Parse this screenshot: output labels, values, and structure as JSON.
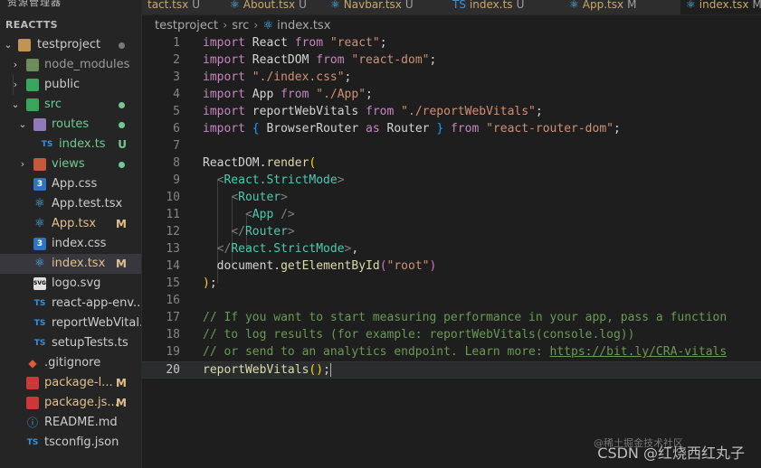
{
  "sidebar": {
    "header_partial": "资源管理器",
    "title": "REACTTS",
    "items": [
      {
        "label": "testproject",
        "status": "dot"
      },
      {
        "label": "node_modules",
        "status": ""
      },
      {
        "label": "public",
        "status": ""
      },
      {
        "label": "src",
        "status": "dot"
      },
      {
        "label": "routes",
        "status": "dot"
      },
      {
        "label": "index.ts",
        "status": "U"
      },
      {
        "label": "views",
        "status": "dot"
      },
      {
        "label": "App.css",
        "status": ""
      },
      {
        "label": "App.test.tsx",
        "status": ""
      },
      {
        "label": "App.tsx",
        "status": "M"
      },
      {
        "label": "index.css",
        "status": ""
      },
      {
        "label": "index.tsx",
        "status": "M"
      },
      {
        "label": "logo.svg",
        "status": ""
      },
      {
        "label": "react-app-env....",
        "status": ""
      },
      {
        "label": "reportWebVital...",
        "status": ""
      },
      {
        "label": "setupTests.ts",
        "status": ""
      },
      {
        "label": ".gitignore",
        "status": ""
      },
      {
        "label": "package-l...",
        "status": "M"
      },
      {
        "label": "package.js...",
        "status": "M"
      },
      {
        "label": "README.md",
        "status": ""
      },
      {
        "label": "tsconfig.json",
        "status": ""
      }
    ]
  },
  "tabs": [
    {
      "label": "tact.tsx",
      "status": "U"
    },
    {
      "label": "About.tsx",
      "status": "U"
    },
    {
      "label": "Navbar.tsx",
      "status": "U"
    },
    {
      "label": "index.ts",
      "status": "U"
    },
    {
      "label": "App.tsx",
      "status": "M"
    },
    {
      "label": "index.tsx",
      "status": "M"
    }
  ],
  "breadcrumb": {
    "project": "testproject",
    "folder": "src",
    "file": "index.tsx"
  },
  "editor": {
    "line_numbers": [
      "1",
      "2",
      "3",
      "4",
      "5",
      "6",
      "7",
      "8",
      "9",
      "10",
      "11",
      "12",
      "13",
      "14",
      "15",
      "16",
      "17",
      "18",
      "19",
      "20"
    ],
    "current_line": "20"
  },
  "watermark": {
    "small": "@稀土掘金技术社区",
    "main": "CSDN @红烧西红丸子"
  },
  "colors": {
    "keyword": "#569cd6",
    "control": "#c586c0",
    "string": "#ce9178",
    "tag": "#4ec9b0",
    "comment": "#6a9955",
    "modified": "#e2c08d",
    "untracked": "#73c991"
  }
}
